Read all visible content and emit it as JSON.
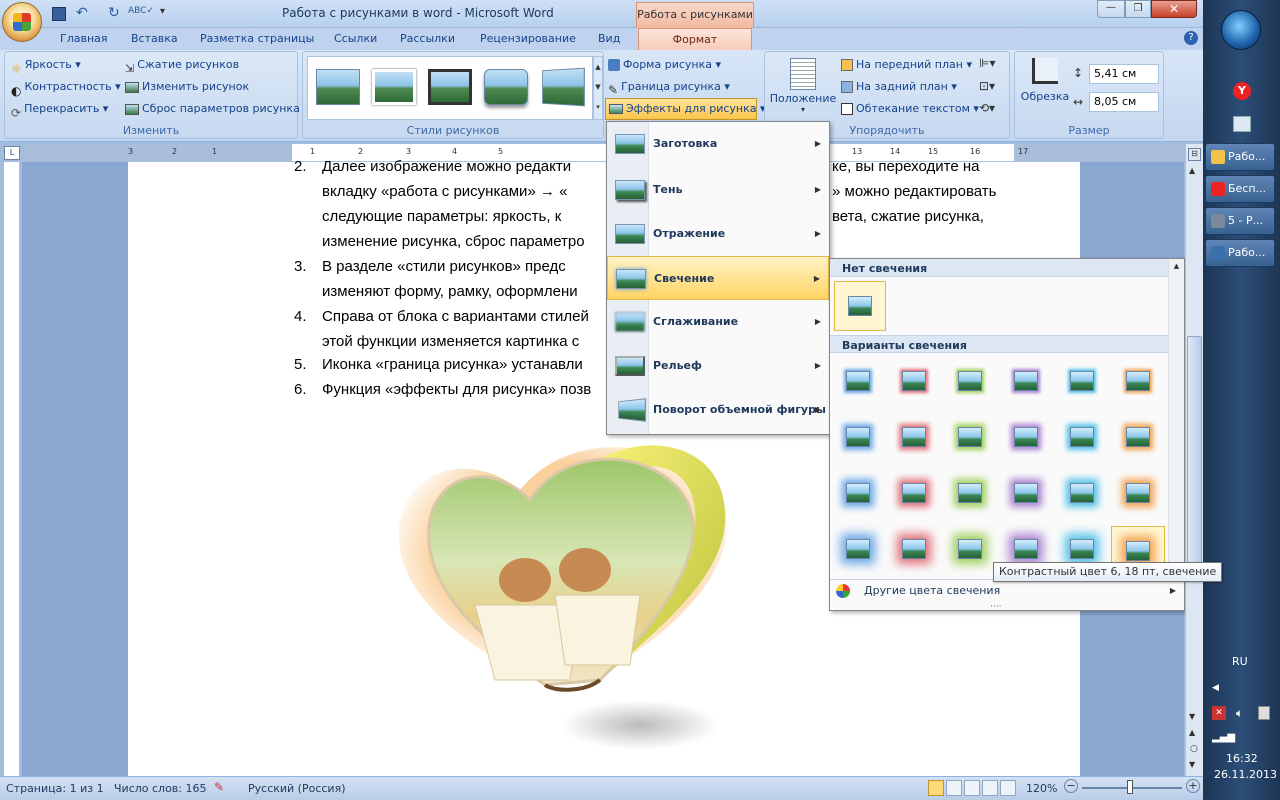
{
  "window": {
    "title": "Работа с рисунками в word - Microsoft Word",
    "context_tab": "Работа с рисунками"
  },
  "ribbon_tabs": [
    "Главная",
    "Вставка",
    "Разметка страницы",
    "Ссылки",
    "Рассылки",
    "Рецензирование",
    "Вид",
    "Формат"
  ],
  "groups": {
    "adjust": {
      "label": "Изменить",
      "brightness": "Яркость",
      "contrast": "Контрастность",
      "recolor": "Перекрасить",
      "compress": "Сжатие рисунков",
      "change_picture": "Изменить рисунок",
      "reset": "Сброс параметров рисунка"
    },
    "styles": {
      "label": "Стили рисунков",
      "shape": "Форма рисунка",
      "border": "Граница рисунка",
      "effects": "Эффекты для рисунка"
    },
    "arrange": {
      "label": "Упорядочить",
      "position": "Положение",
      "front": "На передний план",
      "back": "На задний план",
      "wrap": "Обтекание текстом"
    },
    "size": {
      "label": "Размер",
      "crop": "Обрезка",
      "height": "5,41 см",
      "width": "8,05 см"
    }
  },
  "effects_menu": [
    "Заготовка",
    "Тень",
    "Отражение",
    "Свечение",
    "Сглаживание",
    "Рельеф",
    "Поворот объемной фигуры"
  ],
  "glow_panel": {
    "no_glow_header": "Нет свечения",
    "variants_header": "Варианты свечения",
    "more_colors": "Другие цвета свечения",
    "tooltip": "Контрастный цвет 6, 18 пт, свечение"
  },
  "glow_colors": [
    "#6aa7e6",
    "#e0707a",
    "#9fcf5a",
    "#a882d0",
    "#4fc0e8",
    "#f2a04e"
  ],
  "document": {
    "lines": [
      {
        "num": "2.",
        "text": "Далее изображение можно редакти"
      },
      {
        "num": "",
        "text": "вкладку «работа с рисунками» → «"
      },
      {
        "num": "",
        "text": "следующие параметры: яркость, к"
      },
      {
        "num": "",
        "text": "изменение рисунка, сброс параметро"
      },
      {
        "num": "3.",
        "text": "В разделе «стили рисунков» предс"
      },
      {
        "num": "",
        "text": "изменяют форму, рамку, оформлени"
      },
      {
        "num": "4.",
        "text": "Справа от блока с вариантами стилей"
      },
      {
        "num": "",
        "text": "этой функции изменяется картинка  с"
      },
      {
        "num": "5.",
        "text": "Иконка «граница рисунка» устанавли"
      },
      {
        "num": "6.",
        "text": "Функция «эффекты для рисунка» позв"
      }
    ],
    "right_fragments": [
      "ке,  вы  переходите  на",
      "» можно редактировать",
      "вета,   сжатие   рисунка,"
    ]
  },
  "ruler_numbers": [
    "3",
    "2",
    "1",
    "1",
    "2",
    "3",
    "4",
    "5",
    "13",
    "14",
    "15",
    "16",
    "17"
  ],
  "status_bar": {
    "page": "Страница: 1 из 1",
    "words": "Число слов: 165",
    "language": "Русский (Россия)",
    "zoom": "120%"
  },
  "taskbar": {
    "items": [
      "Рабо...",
      "Бесп...",
      "5 - Р...",
      "Рабо..."
    ],
    "lang": "RU",
    "time": "16:32",
    "date": "26.11.2013"
  }
}
